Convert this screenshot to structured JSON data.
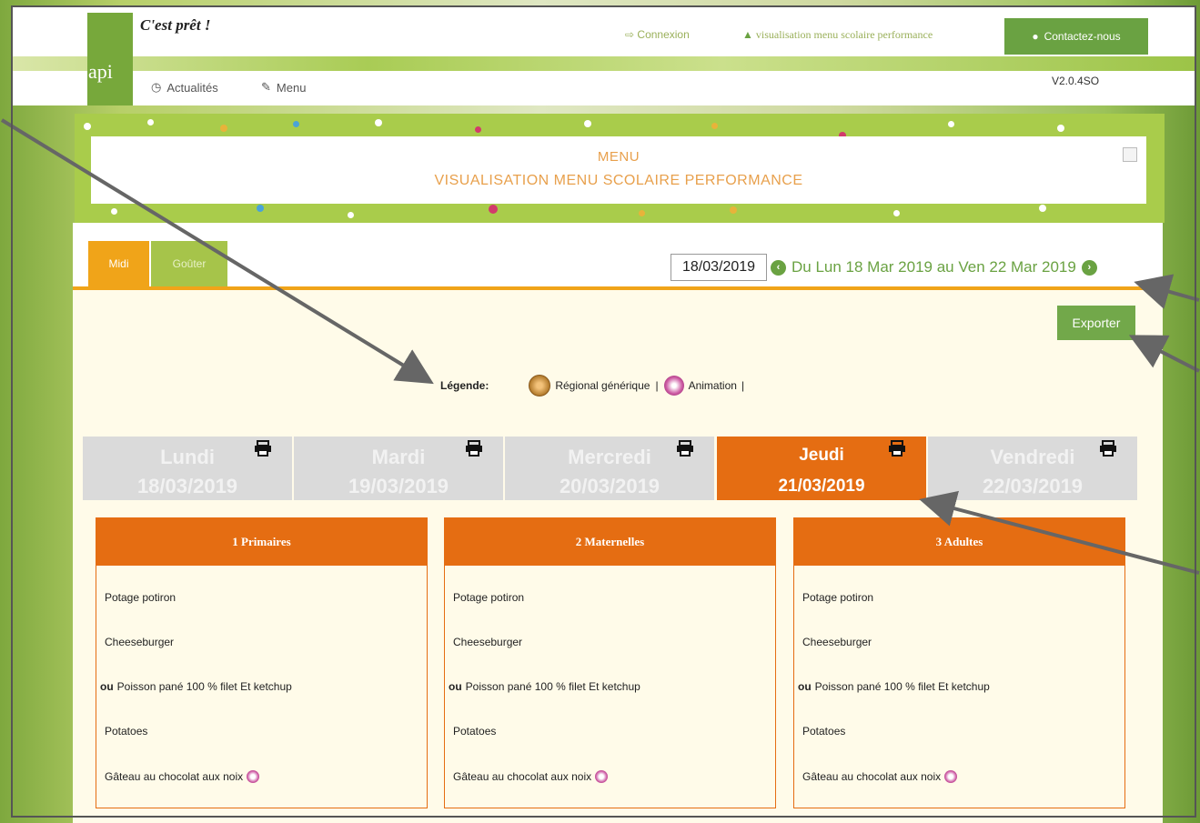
{
  "header": {
    "logo_text": "api",
    "brand_text": "C'est prêt !",
    "connexion_label": "Connexion",
    "performance_label": "visualisation menu scolaire performance",
    "contact_label": "Contactez-nous",
    "version": "V2.0.4SO"
  },
  "nav": {
    "actualites_label": "Actualités",
    "menu_label": "Menu"
  },
  "banner": {
    "line1": "MENU",
    "line2": "VISUALISATION MENU SCOLAIRE PERFORMANCE"
  },
  "tabs": {
    "midi": "Midi",
    "gouter": "Goûter"
  },
  "week": {
    "date_value": "18/03/2019",
    "range_label": "Du Lun 18 Mar 2019 au Ven 22 Mar 2019"
  },
  "export_label": "Exporter",
  "legend": {
    "title": "Légende:",
    "regional": "Régional générique",
    "animation": "Animation",
    "sep": "|"
  },
  "days": [
    {
      "name": "Lundi",
      "date": "18/03/2019"
    },
    {
      "name": "Mardi",
      "date": "19/03/2019"
    },
    {
      "name": "Mercredi",
      "date": "20/03/2019"
    },
    {
      "name": "Jeudi",
      "date": "21/03/2019"
    },
    {
      "name": "Vendredi",
      "date": "22/03/2019"
    }
  ],
  "cards": [
    {
      "title": "1 Primaires",
      "items": [
        "Potage potiron",
        "Cheeseburger",
        "Poisson pané 100 % filet Et ketchup",
        "Potatoes",
        "Gâteau au chocolat aux noix"
      ],
      "ou": "ou"
    },
    {
      "title": "2 Maternelles",
      "items": [
        "Potage potiron",
        "Cheeseburger",
        "Poisson pané 100 % filet Et ketchup",
        "Potatoes",
        "Gâteau au chocolat aux noix"
      ],
      "ou": "ou"
    },
    {
      "title": "3 Adultes",
      "items": [
        "Potage potiron",
        "Cheeseburger",
        "Poisson pané 100 % filet Et ketchup",
        "Potatoes",
        "Gâteau au chocolat aux noix"
      ],
      "ou": "ou"
    }
  ],
  "colors": {
    "brand_green": "#6aa242",
    "tab_orange": "#f0a419",
    "day_active": "#e56d12"
  }
}
